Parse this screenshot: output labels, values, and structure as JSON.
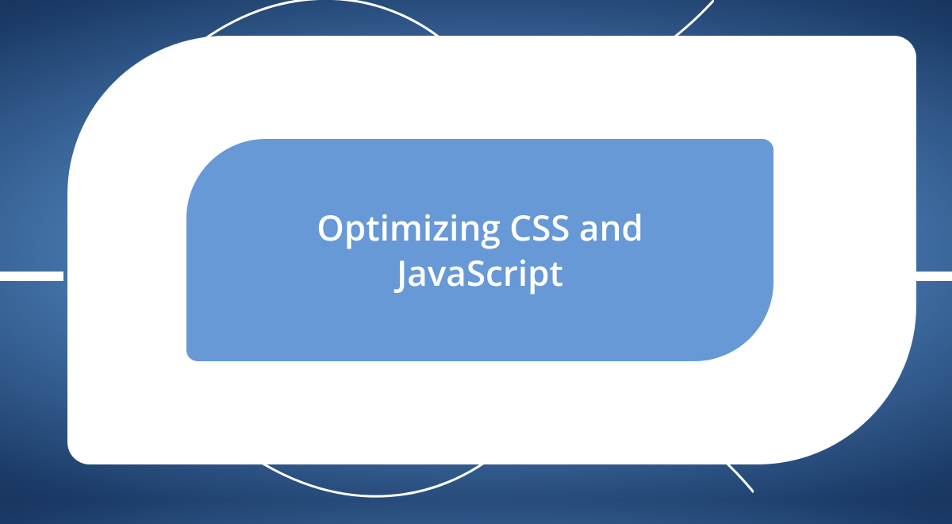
{
  "title": "Optimizing CSS and JavaScript",
  "colors": {
    "bg_outer_dark": "#0a1930",
    "bg_mid": "#1b3a66",
    "bg_center": "#6fa8dc",
    "shape_white": "#ffffff",
    "inner_blue": "#6699d6",
    "text": "#ffffff"
  }
}
